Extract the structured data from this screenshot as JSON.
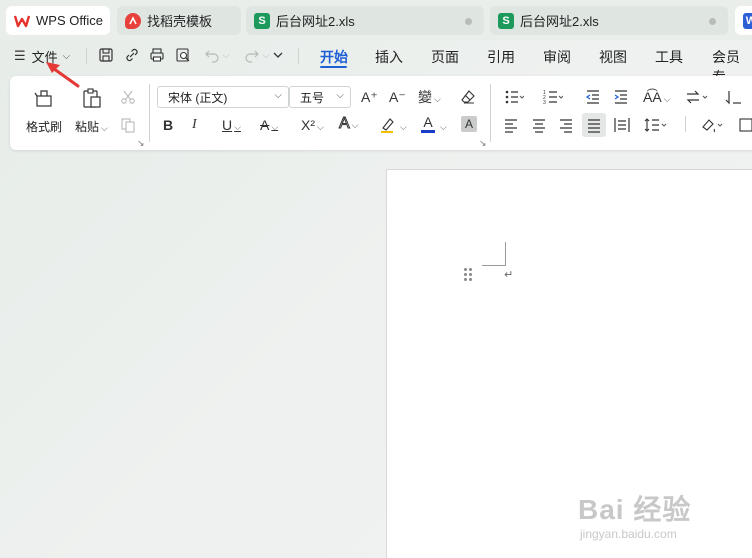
{
  "tabs": [
    {
      "label": "WPS Office",
      "icon": "wps-logo-icon"
    },
    {
      "label": "找稻壳模板",
      "icon": "docer-icon"
    },
    {
      "label": "后台网址2.xls",
      "icon": "spreadsheet-icon",
      "letter": "S"
    },
    {
      "label": "后台网址2.xls",
      "icon": "spreadsheet-icon",
      "letter": "S"
    },
    {
      "label": "",
      "icon": "document-icon",
      "letter": "W"
    }
  ],
  "menu": {
    "file_label": "文件",
    "ribbon_tabs": [
      "开始",
      "插入",
      "页面",
      "引用",
      "审阅",
      "视图",
      "工具",
      "会员专"
    ],
    "active_tab": "开始"
  },
  "ribbon": {
    "format_painter_label": "格式刷",
    "paste_label": "粘贴",
    "font_name": "宋体 (正文)",
    "font_size": "五号",
    "bold": "B",
    "italic": "I",
    "underline": "U",
    "superscript": "X²",
    "font_color_glyph": "A",
    "char_shading": "A",
    "grow_font": "A⁺",
    "shrink_font": "A⁻",
    "pinyin": "變"
  },
  "colors": {
    "accent": "#1f5fd6",
    "sheet_green": "#1d9a5b",
    "wps_red": "#e5322d",
    "font_color_bar": "#1a3cc8",
    "highlight": "#f2c200",
    "arrow_red": "#e53935"
  },
  "watermark": {
    "brand": "Bai 经验",
    "sub": "jingyan.baidu.com"
  }
}
